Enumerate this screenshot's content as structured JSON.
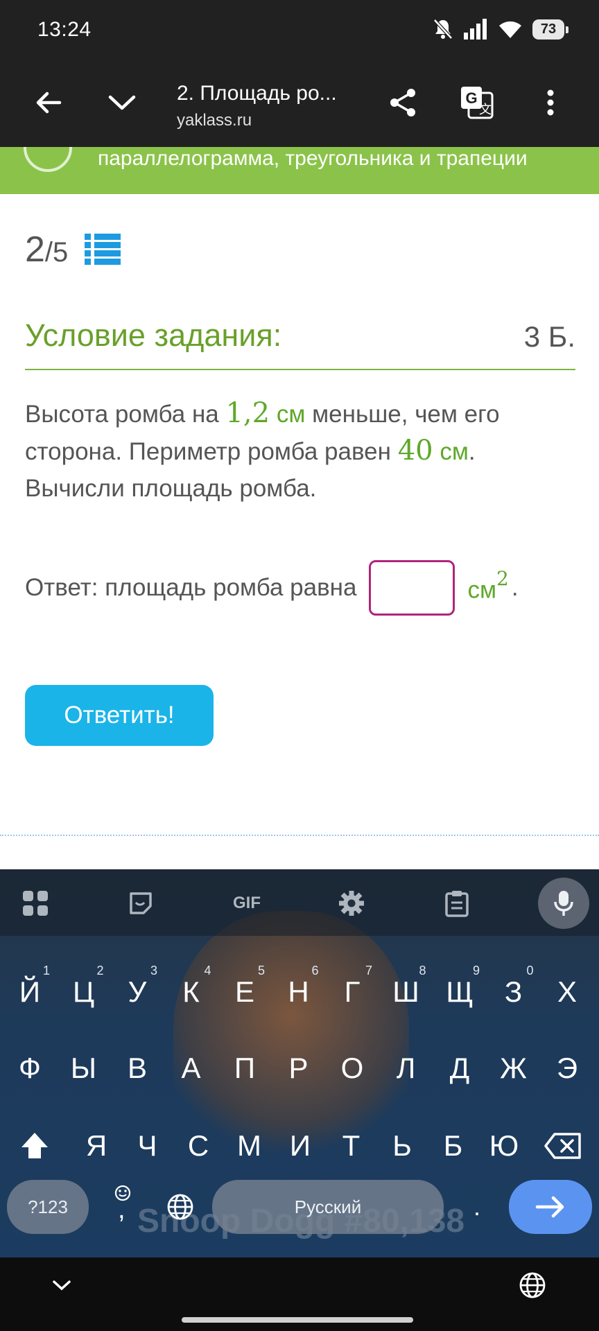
{
  "status_bar": {
    "time": "13:24",
    "battery": "73"
  },
  "browser": {
    "page_title": "2. Площадь ро...",
    "url": "yaklass.ru"
  },
  "banner": {
    "text": "параллелограмма, треугольника и трапеции"
  },
  "progress": {
    "current": "2",
    "total": "/5"
  },
  "condition": {
    "title": "Условие задания:",
    "points": "3 Б."
  },
  "task": {
    "t1": "Высота ромба на ",
    "n1": "1,2",
    "u1": " см",
    "t2": " меньше, чем его сторона. Периметр ромба равен ",
    "n2": "40",
    "u2": " см",
    "t3": ". Вычисли площадь ромба."
  },
  "answer": {
    "label": "Ответ: площадь ромба равна",
    "value": "",
    "unit": "см",
    "unit_power": "2",
    "period": "."
  },
  "submit_label": "Ответить!",
  "keyboard": {
    "toolbar": {
      "gif_label": "GIF"
    },
    "row1": [
      {
        "k": "Й",
        "h": "1"
      },
      {
        "k": "Ц",
        "h": "2"
      },
      {
        "k": "У",
        "h": "3"
      },
      {
        "k": "К",
        "h": "4"
      },
      {
        "k": "Е",
        "h": "5"
      },
      {
        "k": "Н",
        "h": "6"
      },
      {
        "k": "Г",
        "h": "7"
      },
      {
        "k": "Ш",
        "h": "8"
      },
      {
        "k": "Щ",
        "h": "9"
      },
      {
        "k": "З",
        "h": "0"
      },
      {
        "k": "Х",
        "h": ""
      }
    ],
    "row2": [
      "Ф",
      "Ы",
      "В",
      "А",
      "П",
      "Р",
      "О",
      "Л",
      "Д",
      "Ж",
      "Э"
    ],
    "row3": [
      "Я",
      "Ч",
      "С",
      "М",
      "И",
      "Т",
      "Ь",
      "Б",
      "Ю"
    ],
    "symbols_label": "?123",
    "comma_label": ",",
    "space_label": "Русский",
    "dot_label": ".",
    "watermark": "Snoop Dogg #80,138"
  },
  "colors": {
    "accent_green": "#5fa82a",
    "banner_green": "#8bc34a",
    "button_blue": "#1ab4e8",
    "input_border": "#b0247a"
  }
}
